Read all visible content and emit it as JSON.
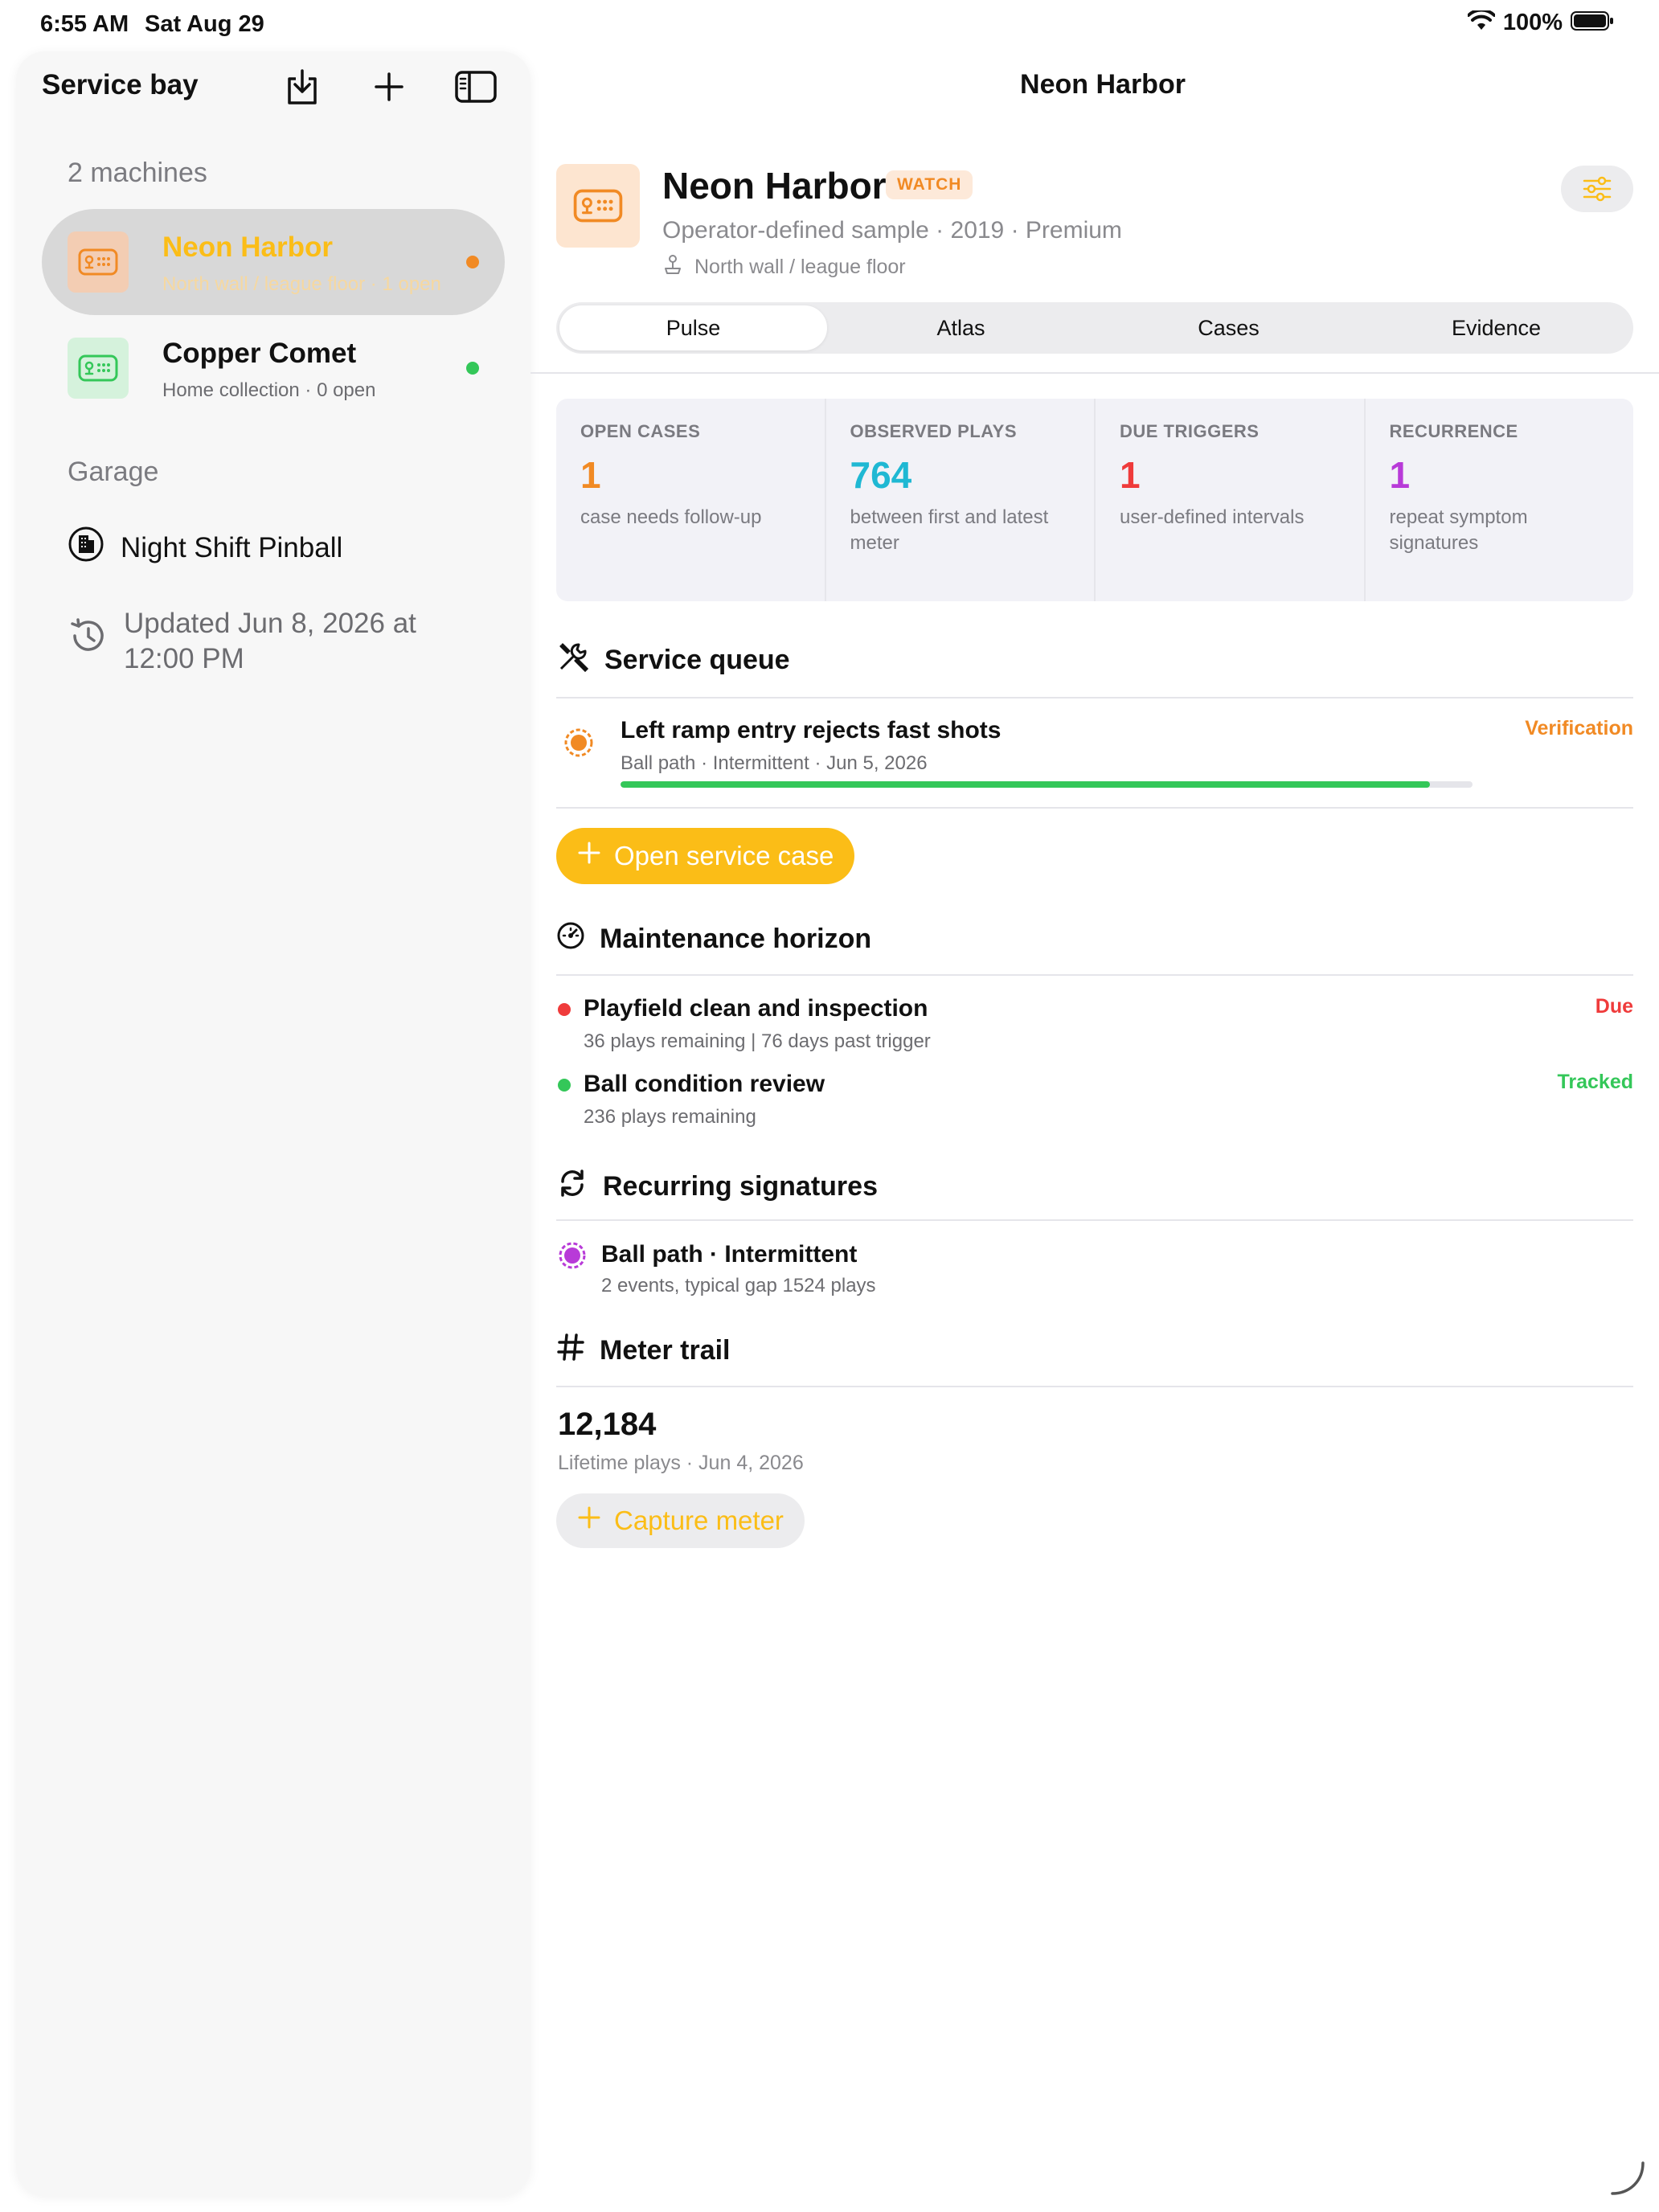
{
  "status_bar": {
    "time": "6:55 AM",
    "date": "Sat Aug 29",
    "battery": "100%"
  },
  "sidebar": {
    "title": "Service bay",
    "machines_label": "2 machines",
    "machines": [
      {
        "name": "Neon Harbor",
        "sub": "North wall / league floor  ·  1 open",
        "accent": "#fbbd17",
        "dot": "#f18a24"
      },
      {
        "name": "Copper Comet",
        "sub": "Home collection  ·  0 open",
        "accent": "#111111",
        "dot": "#34c759"
      }
    ],
    "garage_label": "Garage",
    "garage_item": "Night Shift Pinball",
    "updated": "Updated Jun 8, 2026 at 12:00 PM"
  },
  "main": {
    "nav_title": "Neon Harbor",
    "hero": {
      "name": "Neon Harbor",
      "badge": "WATCH",
      "sub": "Operator-defined sample  ·  2019  ·  Premium",
      "location": "North wall / league floor"
    },
    "tabs": [
      "Pulse",
      "Atlas",
      "Cases",
      "Evidence"
    ],
    "active_tab": "Pulse",
    "stats": [
      {
        "label": "OPEN CASES",
        "value": "1",
        "desc": "case needs follow-up",
        "color": "#f18a24"
      },
      {
        "label": "OBSERVED PLAYS",
        "value": "764",
        "desc": "between first and latest meter",
        "color": "#1fb8d3"
      },
      {
        "label": "DUE TRIGGERS",
        "value": "1",
        "desc": "user-defined intervals",
        "color": "#ef3b3b"
      },
      {
        "label": "RECURRENCE",
        "value": "1",
        "desc": "repeat symptom signatures",
        "color": "#b83ad8"
      }
    ],
    "service_queue": {
      "heading": "Service queue",
      "item": {
        "title": "Left ramp entry rejects fast shots",
        "sub": "Ball path · Intermittent · Jun 5, 2026",
        "status": "Verification",
        "progress": 0.95
      },
      "open_button": "Open service case"
    },
    "maintenance": {
      "heading": "Maintenance horizon",
      "items": [
        {
          "title": "Playfield clean and inspection",
          "sub": "36 plays remaining | 76 days past trigger",
          "status": "Due",
          "color": "#ef3b3b"
        },
        {
          "title": "Ball condition review",
          "sub": "236 plays remaining",
          "status": "Tracked",
          "color": "#34c759"
        }
      ]
    },
    "recurring": {
      "heading": "Recurring signatures",
      "item": {
        "title": "Ball path · Intermittent",
        "sub": "2 events, typical gap 1524 plays"
      }
    },
    "meter": {
      "heading": "Meter trail",
      "value": "12,184",
      "sub": "Lifetime plays · Jun 4, 2026",
      "capture_button": "Capture meter"
    }
  }
}
